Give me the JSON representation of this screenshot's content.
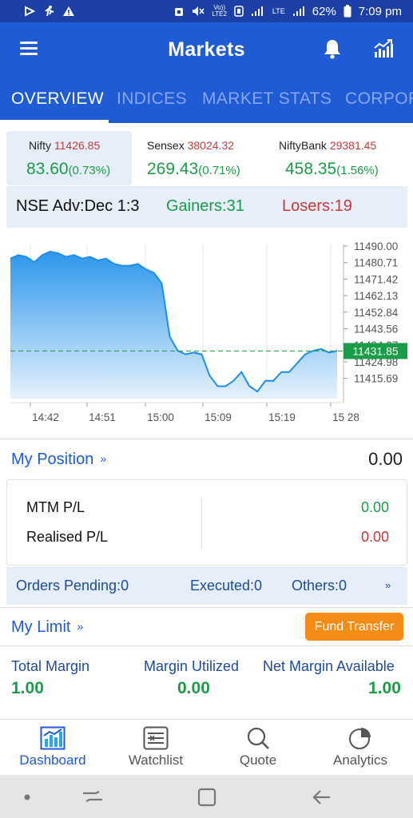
{
  "status_bar": {
    "battery": "62%",
    "time": "7:09 pm",
    "volte": "Vo))\nLTE2",
    "lte": "LTE"
  },
  "app_bar": {
    "title": "Markets",
    "icons": [
      "menu-icon",
      "bell-icon",
      "chart-icon"
    ]
  },
  "tabs": [
    {
      "label": "OVERVIEW",
      "active": true
    },
    {
      "label": "INDICES",
      "active": false
    },
    {
      "label": "MARKET STATS",
      "active": false
    },
    {
      "label": "CORPOR",
      "active": false
    }
  ],
  "indices": [
    {
      "name": "Nifty",
      "value": "11426.85",
      "change": "83.60",
      "pct": "(0.73%)",
      "selected": true
    },
    {
      "name": "Sensex",
      "value": "38024.32",
      "change": "269.43",
      "pct": "(0.71%)",
      "selected": false
    },
    {
      "name": "NiftyBank",
      "value": "29381.45",
      "change": "458.35",
      "pct": "(1.56%)",
      "selected": false
    }
  ],
  "advances": {
    "nse": "NSE Adv:Dec 1:3",
    "gainers": "Gainers:31",
    "losers": "Losers:19"
  },
  "chart_data": {
    "type": "area",
    "x_ticks": [
      "14:42",
      "14:51",
      "15:00",
      "15:09",
      "15:19",
      "15 28"
    ],
    "y_ticks": [
      "11490.00",
      "11480.71",
      "11471.42",
      "11462.13",
      "11452.84",
      "11443.56",
      "11434.27",
      "11424.98",
      "11415.69"
    ],
    "last_price": "11431.85",
    "ylim": [
      11405,
      11492
    ],
    "reference_value": 11431.85,
    "x": [
      0,
      1,
      2,
      3,
      4,
      5,
      6,
      7,
      8,
      9,
      10,
      11,
      12,
      13,
      14,
      15,
      16,
      17,
      18,
      19,
      20,
      21,
      22,
      23,
      24,
      25,
      26,
      27,
      28,
      29,
      30,
      31,
      32,
      33,
      34,
      35,
      36,
      37,
      38,
      39,
      40,
      41
    ],
    "values": [
      11484,
      11486,
      11485,
      11482,
      11486,
      11488,
      11487,
      11485,
      11486,
      11484,
      11485,
      11483,
      11484,
      11481,
      11480,
      11480,
      11481,
      11478,
      11476,
      11470,
      11440,
      11432,
      11430,
      11431,
      11430,
      11418,
      11412,
      11412,
      11415,
      11420,
      11412,
      11409,
      11415,
      11415,
      11420,
      11420,
      11425,
      11430,
      11432,
      11433,
      11431,
      11432
    ],
    "grid": true,
    "colors": {
      "line": "#1e8ee8",
      "fill_top": "#2c96ec",
      "fill_bottom": "#e6f2fc",
      "ref_line": "#2fa05a",
      "badge": "#1a9c48"
    }
  },
  "position": {
    "title": "My Position",
    "value": "0.00",
    "mtm_label": "MTM P/L",
    "mtm_value": "0.00",
    "realised_label": "Realised P/L",
    "realised_value": "0.00"
  },
  "orders": {
    "pending": "Orders Pending:0",
    "executed": "Executed:0",
    "others": "Others:0"
  },
  "limit": {
    "title": "My Limit",
    "fund_transfer": "Fund Transfer",
    "total_margin_label": "Total Margin",
    "total_margin": "1.00",
    "margin_utilized_label": "Margin Utilized",
    "margin_utilized": "0.00",
    "net_margin_label": "Net Margin Available",
    "net_margin": "1.00"
  },
  "bottom_nav": [
    {
      "label": "Dashboard",
      "icon": "dashboard-icon",
      "active": true
    },
    {
      "label": "Watchlist",
      "icon": "watchlist-icon",
      "active": false
    },
    {
      "label": "Quote",
      "icon": "quote-search-icon",
      "active": false
    },
    {
      "label": "Analytics",
      "icon": "analytics-pie-icon",
      "active": false
    }
  ],
  "colors": {
    "brand": "#1e5bd4",
    "positive": "#1a9c48",
    "negative": "#c8393a",
    "accent": "#f48c16"
  }
}
